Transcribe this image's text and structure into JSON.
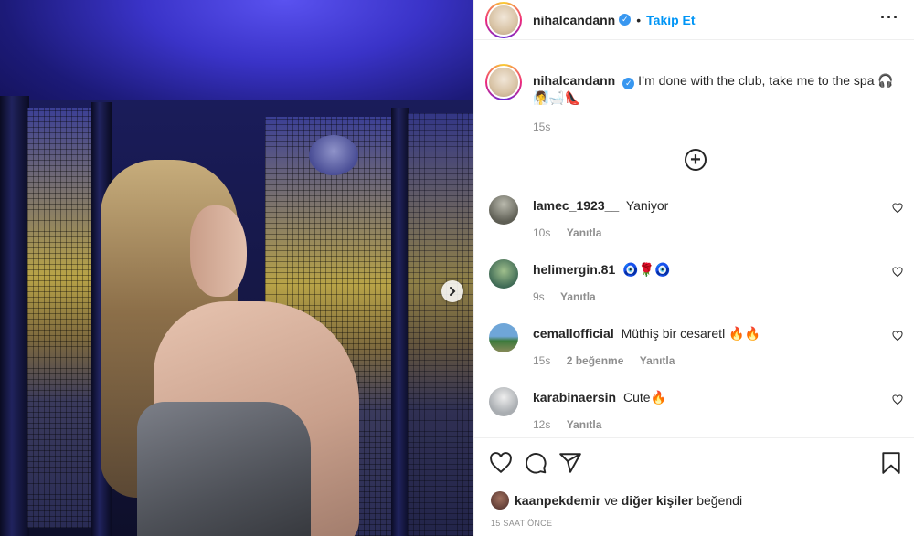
{
  "post": {
    "username": "nihalcandann",
    "follow_label": "Takip Et",
    "dot": "•",
    "more_label": "···",
    "caption": {
      "username": "nihalcandann",
      "text": "I’m done with the club, take me to the spa 🎧🧖‍♀️🛁👠",
      "time": "15s"
    }
  },
  "comments": [
    {
      "username": "lamec_1923__",
      "text": "Yaniyor",
      "time": "10s",
      "likes": "",
      "reply": "Yanıtla",
      "avatar_color": "#7b7a6e"
    },
    {
      "username": "helimergin.81",
      "text": "🧿🌹🧿",
      "time": "9s",
      "likes": "",
      "reply": "Yanıtla",
      "avatar_color": "#6a8a6a"
    },
    {
      "username": "cemallofficial",
      "text": "Müthiş bir cesaretl 🔥🔥",
      "time": "15s",
      "likes": "2 beğenme",
      "reply": "Yanıtla",
      "avatar_color": "#4f7fa6"
    },
    {
      "username": "karabinaersin",
      "text": "Cute🔥",
      "time": "12s",
      "likes": "",
      "reply": "Yanıtla",
      "avatar_color": "#bfc3c7"
    }
  ],
  "liked_by": {
    "user": "kaanpekdemir",
    "connector": "ve",
    "others": "diğer kişiler",
    "suffix": "beğendi"
  },
  "timestamp": "15 SAAT ÖNCE",
  "icons": {
    "like": "heart-icon",
    "comment": "comment-icon",
    "share": "share-icon",
    "save": "bookmark-icon",
    "next": "chevron-right-icon",
    "load_more": "plus-circle-icon"
  },
  "colors": {
    "accent": "#0095f6",
    "verified": "#3897f0",
    "muted": "#8e8e8e"
  }
}
